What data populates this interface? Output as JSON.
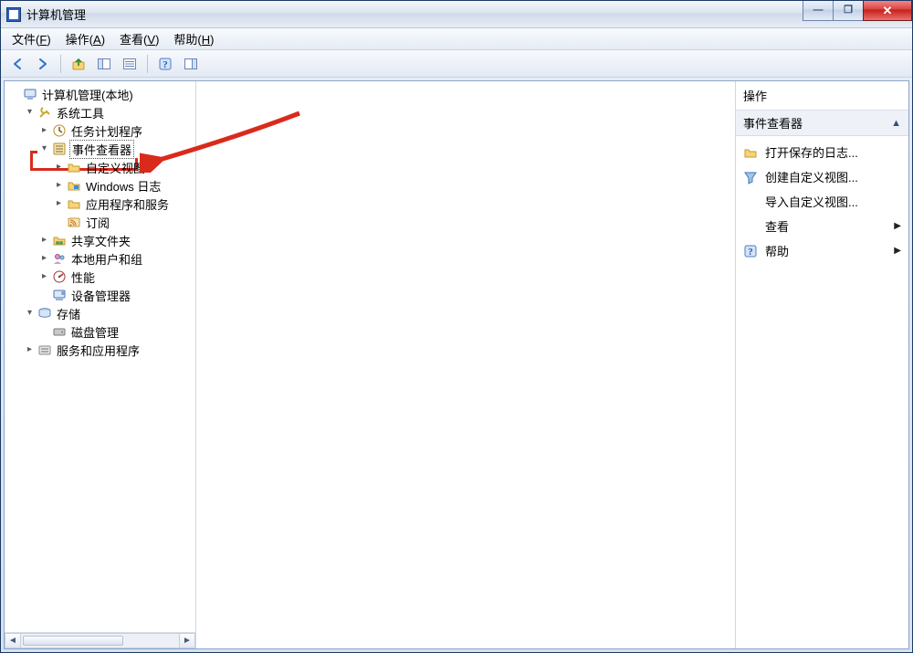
{
  "window": {
    "title": "计算机管理"
  },
  "menubar": {
    "file": {
      "label": "文件",
      "accel": "F"
    },
    "action": {
      "label": "操作",
      "accel": "A"
    },
    "view": {
      "label": "查看",
      "accel": "V"
    },
    "help": {
      "label": "帮助",
      "accel": "H"
    }
  },
  "tree": {
    "root": "计算机管理(本地)",
    "system_tools": "系统工具",
    "task_scheduler": "任务计划程序",
    "event_viewer": "事件查看器",
    "custom_views": "自定义视图",
    "windows_logs": "Windows 日志",
    "app_service_logs": "应用程序和服务",
    "subscriptions": "订阅",
    "shared_folders": "共享文件夹",
    "local_users": "本地用户和组",
    "performance": "性能",
    "device_manager": "设备管理器",
    "storage": "存储",
    "disk_management": "磁盘管理",
    "services_apps": "服务和应用程序"
  },
  "actions": {
    "header": "操作",
    "section": "事件查看器",
    "open_saved_log": "打开保存的日志...",
    "create_custom_view": "创建自定义视图...",
    "import_custom_view": "导入自定义视图...",
    "view": "查看",
    "help": "帮助"
  },
  "win_controls": {
    "minimize": "—",
    "maximize": "❐",
    "close": "✕"
  }
}
